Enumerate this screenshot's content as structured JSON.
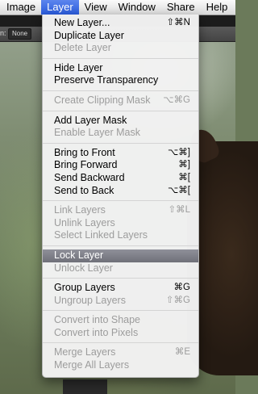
{
  "menubar": {
    "items": [
      "Image",
      "Layer",
      "View",
      "Window",
      "Share",
      "Help"
    ]
  },
  "options": {
    "label": "n:",
    "select_value": "None"
  },
  "layer_menu": {
    "groups": [
      [
        {
          "label": "New Layer...",
          "shortcut": "⇧⌘N",
          "enabled": true
        },
        {
          "label": "Duplicate Layer",
          "shortcut": "",
          "enabled": true
        },
        {
          "label": "Delete Layer",
          "shortcut": "",
          "enabled": false
        }
      ],
      [
        {
          "label": "Hide Layer",
          "shortcut": "",
          "enabled": true
        },
        {
          "label": "Preserve Transparency",
          "shortcut": "",
          "enabled": true
        }
      ],
      [
        {
          "label": "Create Clipping Mask",
          "shortcut": "⌥⌘G",
          "enabled": false
        }
      ],
      [
        {
          "label": "Add Layer Mask",
          "shortcut": "",
          "enabled": true
        },
        {
          "label": "Enable Layer Mask",
          "shortcut": "",
          "enabled": false
        }
      ],
      [
        {
          "label": "Bring to Front",
          "shortcut": "⌥⌘]",
          "enabled": true
        },
        {
          "label": "Bring Forward",
          "shortcut": "⌘]",
          "enabled": true
        },
        {
          "label": "Send Backward",
          "shortcut": "⌘[",
          "enabled": true
        },
        {
          "label": "Send to Back",
          "shortcut": "⌥⌘[",
          "enabled": true
        }
      ],
      [
        {
          "label": "Link Layers",
          "shortcut": "⇧⌘L",
          "enabled": false
        },
        {
          "label": "Unlink Layers",
          "shortcut": "",
          "enabled": false
        },
        {
          "label": "Select Linked Layers",
          "shortcut": "",
          "enabled": false
        }
      ],
      [
        {
          "label": "Lock Layer",
          "shortcut": "",
          "enabled": true,
          "highlighted": true
        },
        {
          "label": "Unlock Layer",
          "shortcut": "",
          "enabled": false
        }
      ],
      [
        {
          "label": "Group Layers",
          "shortcut": "⌘G",
          "enabled": true
        },
        {
          "label": "Ungroup Layers",
          "shortcut": "⇧⌘G",
          "enabled": false
        }
      ],
      [
        {
          "label": "Convert into Shape",
          "shortcut": "",
          "enabled": false
        },
        {
          "label": "Convert into Pixels",
          "shortcut": "",
          "enabled": false
        }
      ],
      [
        {
          "label": "Merge Layers",
          "shortcut": "⌘E",
          "enabled": false
        },
        {
          "label": "Merge All Layers",
          "shortcut": "",
          "enabled": false
        }
      ]
    ]
  },
  "colors": {
    "menu_active": "#2a5bdb",
    "highlight_row": "#7b7c85",
    "disabled_text": "#9c9c9c"
  }
}
